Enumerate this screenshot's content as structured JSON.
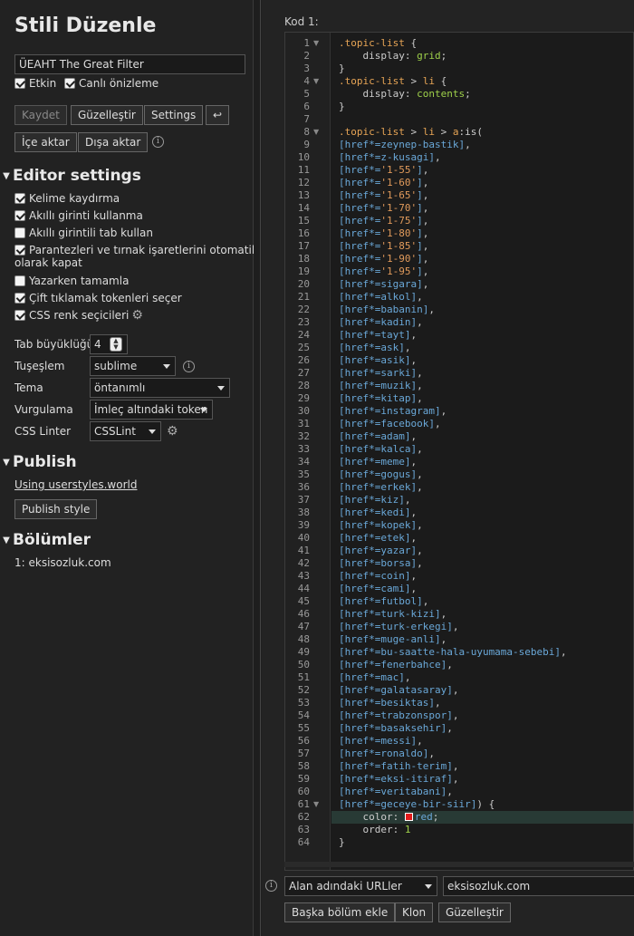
{
  "sidebar": {
    "title": "Stili Düzenle",
    "style_name": "ÜEAHT The Great Filter",
    "enabled_label": "Etkin",
    "live_preview_label": "Canlı önizleme",
    "buttons": {
      "save": "Kaydet",
      "beautify": "Güzelleştir",
      "settings": "Settings",
      "undo_icon": "↩",
      "import": "İçe aktar",
      "export": "Dışa aktar",
      "info": "i"
    },
    "editor_settings": {
      "heading": "Editor settings",
      "options": [
        {
          "label": "Kelime kaydırma",
          "checked": true
        },
        {
          "label": "Akıllı girinti kullanma",
          "checked": true
        },
        {
          "label": "Akıllı girintili tab kullan",
          "checked": false
        },
        {
          "label": "Parantezleri ve tırnak işaretlerini otomatik",
          "label2": "olarak kapat",
          "checked": true
        },
        {
          "label": "Yazarken tamamla",
          "checked": false
        },
        {
          "label": "Çift tıklamak tokenleri seçer",
          "checked": true
        },
        {
          "label": "CSS renk seçicileri",
          "checked": true
        }
      ],
      "tab_size_label": "Tab büyüklüğü",
      "tab_size_value": "4",
      "keymap_label": "Tuşeşlem",
      "keymap_value": "sublime",
      "theme_label": "Tema",
      "theme_value": "öntanımlı",
      "highlight_label": "Vurgulama",
      "highlight_value": "İmleç altındaki token",
      "linter_label": "CSS Linter",
      "linter_value": "CSSLint"
    },
    "publish": {
      "heading": "Publish",
      "link": "Using userstyles.world",
      "button": "Publish style"
    },
    "sections": {
      "heading": "Bölümler",
      "items": [
        "1: eksisozluk.com"
      ]
    }
  },
  "main": {
    "code_label": "Kod 1:",
    "code_lines": [
      [
        [
          "k-sel",
          ".topic-list"
        ],
        [
          "k-pun",
          " {"
        ]
      ],
      [
        [
          "k-prop",
          "    display"
        ],
        [
          "k-pun",
          ": "
        ],
        [
          "k-val",
          "grid"
        ],
        [
          "k-pun",
          ";"
        ]
      ],
      [
        [
          "k-pun",
          "}"
        ]
      ],
      [
        [
          "k-sel",
          ".topic-list"
        ],
        [
          "k-pun",
          " > "
        ],
        [
          "k-sel",
          "li"
        ],
        [
          "k-pun",
          " {"
        ]
      ],
      [
        [
          "k-prop",
          "    display"
        ],
        [
          "k-pun",
          ": "
        ],
        [
          "k-val",
          "contents"
        ],
        [
          "k-pun",
          ";"
        ]
      ],
      [
        [
          "k-pun",
          "}"
        ]
      ],
      [],
      [
        [
          "k-sel",
          ".topic-list"
        ],
        [
          "k-pun",
          " > "
        ],
        [
          "k-sel",
          "li"
        ],
        [
          "k-pun",
          " > "
        ],
        [
          "k-sel",
          "a"
        ],
        [
          "k-pun",
          ":is("
        ]
      ],
      [
        [
          "k-attr",
          "[href*="
        ],
        [
          "k-attr",
          "zeynep-bastik"
        ],
        [
          "k-attr",
          "]"
        ],
        [
          "k-pun",
          ","
        ]
      ],
      [
        [
          "k-attr",
          "[href*="
        ],
        [
          "k-attr",
          "z-kusagi"
        ],
        [
          "k-attr",
          "]"
        ],
        [
          "k-pun",
          ","
        ]
      ],
      [
        [
          "k-attr",
          "[href*="
        ],
        [
          "k-str",
          "'1-55'"
        ],
        [
          "k-attr",
          "]"
        ],
        [
          "k-pun",
          ","
        ]
      ],
      [
        [
          "k-attr",
          "[href*="
        ],
        [
          "k-str",
          "'1-60'"
        ],
        [
          "k-attr",
          "]"
        ],
        [
          "k-pun",
          ","
        ]
      ],
      [
        [
          "k-attr",
          "[href*="
        ],
        [
          "k-str",
          "'1-65'"
        ],
        [
          "k-attr",
          "]"
        ],
        [
          "k-pun",
          ","
        ]
      ],
      [
        [
          "k-attr",
          "[href*="
        ],
        [
          "k-str",
          "'1-70'"
        ],
        [
          "k-attr",
          "]"
        ],
        [
          "k-pun",
          ","
        ]
      ],
      [
        [
          "k-attr",
          "[href*="
        ],
        [
          "k-str",
          "'1-75'"
        ],
        [
          "k-attr",
          "]"
        ],
        [
          "k-pun",
          ","
        ]
      ],
      [
        [
          "k-attr",
          "[href*="
        ],
        [
          "k-str",
          "'1-80'"
        ],
        [
          "k-attr",
          "]"
        ],
        [
          "k-pun",
          ","
        ]
      ],
      [
        [
          "k-attr",
          "[href*="
        ],
        [
          "k-str",
          "'1-85'"
        ],
        [
          "k-attr",
          "]"
        ],
        [
          "k-pun",
          ","
        ]
      ],
      [
        [
          "k-attr",
          "[href*="
        ],
        [
          "k-str",
          "'1-90'"
        ],
        [
          "k-attr",
          "]"
        ],
        [
          "k-pun",
          ","
        ]
      ],
      [
        [
          "k-attr",
          "[href*="
        ],
        [
          "k-str",
          "'1-95'"
        ],
        [
          "k-attr",
          "]"
        ],
        [
          "k-pun",
          ","
        ]
      ],
      [
        [
          "k-attr",
          "[href*=sigara]"
        ],
        [
          "k-pun",
          ","
        ]
      ],
      [
        [
          "k-attr",
          "[href*=alkol]"
        ],
        [
          "k-pun",
          ","
        ]
      ],
      [
        [
          "k-attr",
          "[href*=babanin]"
        ],
        [
          "k-pun",
          ","
        ]
      ],
      [
        [
          "k-attr",
          "[href*=kadin]"
        ],
        [
          "k-pun",
          ","
        ]
      ],
      [
        [
          "k-attr",
          "[href*=tayt]"
        ],
        [
          "k-pun",
          ","
        ]
      ],
      [
        [
          "k-attr",
          "[href*=ask]"
        ],
        [
          "k-pun",
          ","
        ]
      ],
      [
        [
          "k-attr",
          "[href*=asik]"
        ],
        [
          "k-pun",
          ","
        ]
      ],
      [
        [
          "k-attr",
          "[href*=sarki]"
        ],
        [
          "k-pun",
          ","
        ]
      ],
      [
        [
          "k-attr",
          "[href*=muzik]"
        ],
        [
          "k-pun",
          ","
        ]
      ],
      [
        [
          "k-attr",
          "[href*=kitap]"
        ],
        [
          "k-pun",
          ","
        ]
      ],
      [
        [
          "k-attr",
          "[href*=instagram]"
        ],
        [
          "k-pun",
          ","
        ]
      ],
      [
        [
          "k-attr",
          "[href*=facebook]"
        ],
        [
          "k-pun",
          ","
        ]
      ],
      [
        [
          "k-attr",
          "[href*=adam]"
        ],
        [
          "k-pun",
          ","
        ]
      ],
      [
        [
          "k-attr",
          "[href*=kalca]"
        ],
        [
          "k-pun",
          ","
        ]
      ],
      [
        [
          "k-attr",
          "[href*=meme]"
        ],
        [
          "k-pun",
          ","
        ]
      ],
      [
        [
          "k-attr",
          "[href*=gogus]"
        ],
        [
          "k-pun",
          ","
        ]
      ],
      [
        [
          "k-attr",
          "[href*=erkek]"
        ],
        [
          "k-pun",
          ","
        ]
      ],
      [
        [
          "k-attr",
          "[href*=kiz]"
        ],
        [
          "k-pun",
          ","
        ]
      ],
      [
        [
          "k-attr",
          "[href*=kedi]"
        ],
        [
          "k-pun",
          ","
        ]
      ],
      [
        [
          "k-attr",
          "[href*=kopek]"
        ],
        [
          "k-pun",
          ","
        ]
      ],
      [
        [
          "k-attr",
          "[href*=etek]"
        ],
        [
          "k-pun",
          ","
        ]
      ],
      [
        [
          "k-attr",
          "[href*=yazar]"
        ],
        [
          "k-pun",
          ","
        ]
      ],
      [
        [
          "k-attr",
          "[href*=borsa]"
        ],
        [
          "k-pun",
          ","
        ]
      ],
      [
        [
          "k-attr",
          "[href*=coin]"
        ],
        [
          "k-pun",
          ","
        ]
      ],
      [
        [
          "k-attr",
          "[href*=cami]"
        ],
        [
          "k-pun",
          ","
        ]
      ],
      [
        [
          "k-attr",
          "[href*=futbol]"
        ],
        [
          "k-pun",
          ","
        ]
      ],
      [
        [
          "k-attr",
          "[href*=turk-kizi]"
        ],
        [
          "k-pun",
          ","
        ]
      ],
      [
        [
          "k-attr",
          "[href*=turk-erkegi]"
        ],
        [
          "k-pun",
          ","
        ]
      ],
      [
        [
          "k-attr",
          "[href*=muge-anli]"
        ],
        [
          "k-pun",
          ","
        ]
      ],
      [
        [
          "k-attr",
          "[href*=bu-saatte-hala-uyumama-sebebi]"
        ],
        [
          "k-pun",
          ","
        ]
      ],
      [
        [
          "k-attr",
          "[href*=fenerbahce]"
        ],
        [
          "k-pun",
          ","
        ]
      ],
      [
        [
          "k-attr",
          "[href*=mac]"
        ],
        [
          "k-pun",
          ","
        ]
      ],
      [
        [
          "k-attr",
          "[href*=galatasaray]"
        ],
        [
          "k-pun",
          ","
        ]
      ],
      [
        [
          "k-attr",
          "[href*=besiktas]"
        ],
        [
          "k-pun",
          ","
        ]
      ],
      [
        [
          "k-attr",
          "[href*=trabzonspor]"
        ],
        [
          "k-pun",
          ","
        ]
      ],
      [
        [
          "k-attr",
          "[href*=basaksehir]"
        ],
        [
          "k-pun",
          ","
        ]
      ],
      [
        [
          "k-attr",
          "[href*=messi]"
        ],
        [
          "k-pun",
          ","
        ]
      ],
      [
        [
          "k-attr",
          "[href*=ronaldo]"
        ],
        [
          "k-pun",
          ","
        ]
      ],
      [
        [
          "k-attr",
          "[href*=fatih-terim]"
        ],
        [
          "k-pun",
          ","
        ]
      ],
      [
        [
          "k-attr",
          "[href*=eksi-itiraf]"
        ],
        [
          "k-pun",
          ","
        ]
      ],
      [
        [
          "k-attr",
          "[href*=veritabani]"
        ],
        [
          "k-pun",
          ","
        ]
      ],
      [
        [
          "k-attr",
          "[href*=geceye-bir-siir]"
        ],
        [
          "k-pun",
          ") {"
        ]
      ],
      [
        [
          "k-prop",
          "    color"
        ],
        [
          "k-pun",
          ": "
        ],
        [
          "swatch",
          ""
        ],
        [
          "k-attr",
          "red"
        ],
        [
          "k-pun",
          ";"
        ]
      ],
      [
        [
          "k-prop",
          "    order"
        ],
        [
          "k-pun",
          ": "
        ],
        [
          "k-num",
          "1"
        ]
      ],
      [
        [
          "k-pun",
          "}"
        ]
      ]
    ],
    "fold_lines": [
      1,
      4,
      8,
      61
    ],
    "highlight_line": 62,
    "swatch_color": "#e21b1b",
    "applies_to_type": "Alan adındaki URLler",
    "applies_to_value": "eksisozluk.com",
    "bottom_buttons": {
      "add_section": "Başka bölüm ekle",
      "clone": "Klon",
      "beautify": "Güzelleştir"
    }
  }
}
